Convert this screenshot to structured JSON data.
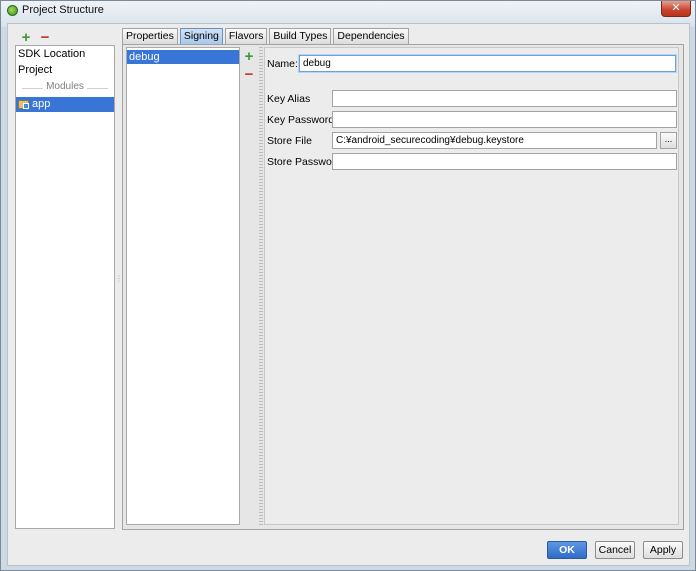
{
  "window": {
    "title": "Project Structure",
    "close_label": "✕"
  },
  "left": {
    "items": [
      "SDK Location",
      "Project"
    ],
    "modules_label": "Modules",
    "module_item": "app"
  },
  "tabs": [
    {
      "label": "Properties"
    },
    {
      "label": "Signing"
    },
    {
      "label": "Flavors"
    },
    {
      "label": "Build Types"
    },
    {
      "label": "Dependencies"
    }
  ],
  "signing": {
    "configs": [
      "debug"
    ],
    "name_label": "Name:",
    "name_value": "debug",
    "key_alias_label": "Key Alias",
    "key_alias_value": "",
    "key_password_label": "Key Password",
    "key_password_value": "",
    "store_file_label": "Store File",
    "store_file_value": "C:¥android_securecoding¥debug.keystore",
    "store_file_browse": "...",
    "store_password_label": "Store Password",
    "store_password_value": ""
  },
  "buttons": {
    "ok": "OK",
    "cancel": "Cancel",
    "apply": "Apply"
  },
  "icons": {
    "add": "+",
    "remove": "−"
  }
}
